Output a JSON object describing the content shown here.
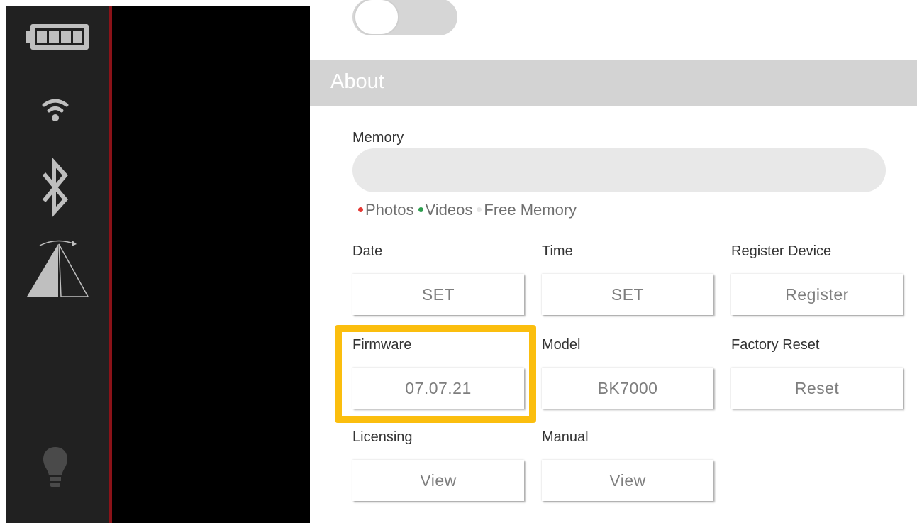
{
  "sidebar": {
    "icons": [
      "battery-full-icon",
      "wifi-icon",
      "bluetooth-icon",
      "level-calibration-icon",
      "lightbulb-icon"
    ]
  },
  "settings": {
    "toggle_state": "off",
    "about_header": "About",
    "memory_label": "Memory",
    "legend": {
      "photos": "Photos",
      "videos": "Videos",
      "free": "Free Memory"
    },
    "items": {
      "date": {
        "label": "Date",
        "button": "SET"
      },
      "time": {
        "label": "Time",
        "button": "SET"
      },
      "register": {
        "label": "Register Device",
        "button": "Register"
      },
      "firmware": {
        "label": "Firmware",
        "button": "07.07.21"
      },
      "model": {
        "label": "Model",
        "button": "BK7000"
      },
      "factory_reset": {
        "label": "Factory Reset",
        "button": "Reset"
      },
      "licensing": {
        "label": "Licensing",
        "button": "View"
      },
      "manual": {
        "label": "Manual",
        "button": "View"
      }
    }
  },
  "colors": {
    "highlight": "#fbbe0e",
    "photos_dot": "#e53935",
    "videos_dot": "#2e9e4f",
    "free_dot": "#e6e6e6",
    "sidebar_accent": "#8b1218"
  }
}
